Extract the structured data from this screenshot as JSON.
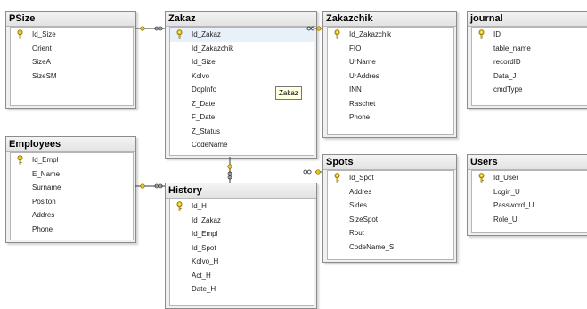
{
  "diagram": {
    "tables": [
      {
        "id": "psize",
        "title": "PSize",
        "columns": [
          {
            "name": "Id_Size",
            "pk": true
          },
          {
            "name": "Orient"
          },
          {
            "name": "SizeA"
          },
          {
            "name": "SizeSM"
          }
        ]
      },
      {
        "id": "zakaz",
        "title": "Zakaz",
        "columns": [
          {
            "name": "Id_Zakaz",
            "pk": true
          },
          {
            "name": "Id_Zakazchik"
          },
          {
            "name": "Id_Size"
          },
          {
            "name": "Kolvo"
          },
          {
            "name": "DopInfo"
          },
          {
            "name": "Z_Date"
          },
          {
            "name": "F_Date"
          },
          {
            "name": "Z_Status"
          },
          {
            "name": "CodeName"
          }
        ]
      },
      {
        "id": "zakazchik",
        "title": "Zakazchik",
        "columns": [
          {
            "name": "Id_Zakazchik",
            "pk": true
          },
          {
            "name": "FIO"
          },
          {
            "name": "UrName"
          },
          {
            "name": "UrAddres"
          },
          {
            "name": "INN"
          },
          {
            "name": "Raschet"
          },
          {
            "name": "Phone"
          }
        ]
      },
      {
        "id": "journal",
        "title": "journal",
        "columns": [
          {
            "name": "ID",
            "pk": true
          },
          {
            "name": "table_name"
          },
          {
            "name": "recordID"
          },
          {
            "name": "Data_J"
          },
          {
            "name": "cmdType"
          }
        ]
      },
      {
        "id": "employees",
        "title": "Employees",
        "columns": [
          {
            "name": "Id_Empl",
            "pk": true
          },
          {
            "name": "E_Name"
          },
          {
            "name": "Surname"
          },
          {
            "name": "Positon"
          },
          {
            "name": "Addres"
          },
          {
            "name": "Phone"
          }
        ]
      },
      {
        "id": "history",
        "title": "History",
        "columns": [
          {
            "name": "Id_H",
            "pk": true
          },
          {
            "name": "Id_Zakaz"
          },
          {
            "name": "Id_Empl"
          },
          {
            "name": "Id_Spot"
          },
          {
            "name": "Kolvo_H"
          },
          {
            "name": "Act_H"
          },
          {
            "name": "Date_H"
          }
        ]
      },
      {
        "id": "spots",
        "title": "Spots",
        "columns": [
          {
            "name": "Id_Spot",
            "pk": true
          },
          {
            "name": "Addres"
          },
          {
            "name": "Sides"
          },
          {
            "name": "SizeSpot"
          },
          {
            "name": "Rout"
          },
          {
            "name": "CodeName_S"
          }
        ]
      },
      {
        "id": "users",
        "title": "Users",
        "columns": [
          {
            "name": "Id_User",
            "pk": true
          },
          {
            "name": "Login_U"
          },
          {
            "name": "Password_U"
          },
          {
            "name": "Role_U"
          }
        ]
      }
    ],
    "relationships": [
      {
        "from": "psize",
        "to": "zakaz"
      },
      {
        "from": "zakazchik",
        "to": "zakaz"
      },
      {
        "from": "employees",
        "to": "history"
      },
      {
        "from": "zakaz",
        "to": "history"
      },
      {
        "from": "spots",
        "to": "history"
      }
    ],
    "tooltip": "Zakaz",
    "colors": {
      "key": "#e8c21a",
      "line": "#3a3a3a",
      "title_bg": "#e6e6e6",
      "canvas": "#ffffff"
    },
    "icons": {
      "primary_key": "key-icon"
    }
  }
}
